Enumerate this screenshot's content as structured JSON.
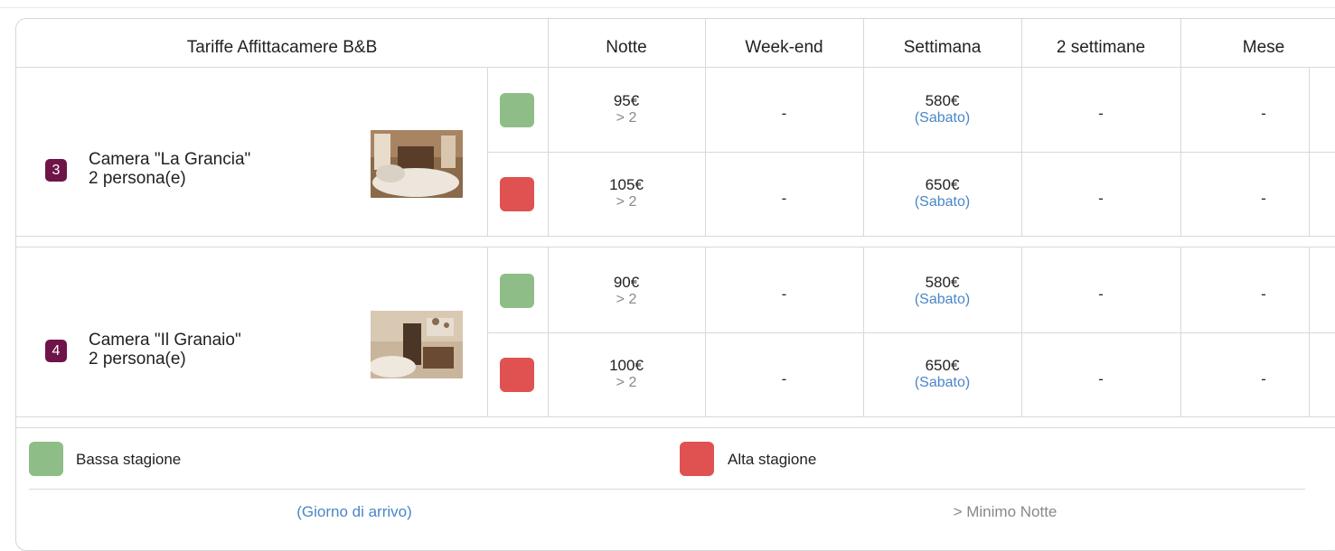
{
  "header": {
    "title": "Tariffe Affittacamere B&B",
    "columns": [
      "Notte",
      "Week-end",
      "Settimana",
      "2 settimane",
      "Mese"
    ]
  },
  "colors": {
    "low_season": "#8fbd87",
    "high_season": "#e05252",
    "badge": "#6e1449",
    "link": "#4a86c8"
  },
  "rooms": [
    {
      "number": "3",
      "name": "Camera \"La Grancia\"",
      "capacity": "2 persona(e)",
      "rates": [
        {
          "season": "low",
          "notte": "95€",
          "min": "> 2",
          "weekend": "-",
          "settimana": "580€",
          "arrival": "(Sabato)",
          "due_settimane": "-",
          "mese": "-"
        },
        {
          "season": "high",
          "notte": "105€",
          "min": "> 2",
          "weekend": "-",
          "settimana": "650€",
          "arrival": "(Sabato)",
          "due_settimane": "-",
          "mese": "-"
        }
      ]
    },
    {
      "number": "4",
      "name": "Camera \"Il Granaio\"",
      "capacity": "2 persona(e)",
      "rates": [
        {
          "season": "low",
          "notte": "90€",
          "min": "> 2",
          "weekend": "-",
          "settimana": "580€",
          "arrival": "(Sabato)",
          "due_settimane": "-",
          "mese": "-"
        },
        {
          "season": "high",
          "notte": "100€",
          "min": "> 2",
          "weekend": "-",
          "settimana": "650€",
          "arrival": "(Sabato)",
          "due_settimane": "-",
          "mese": "-"
        }
      ]
    }
  ],
  "legend": {
    "low_label": "Bassa stagione",
    "high_label": "Alta stagione",
    "arrival_note": "(Giorno di arrivo)",
    "min_note": "> Minimo Notte"
  }
}
